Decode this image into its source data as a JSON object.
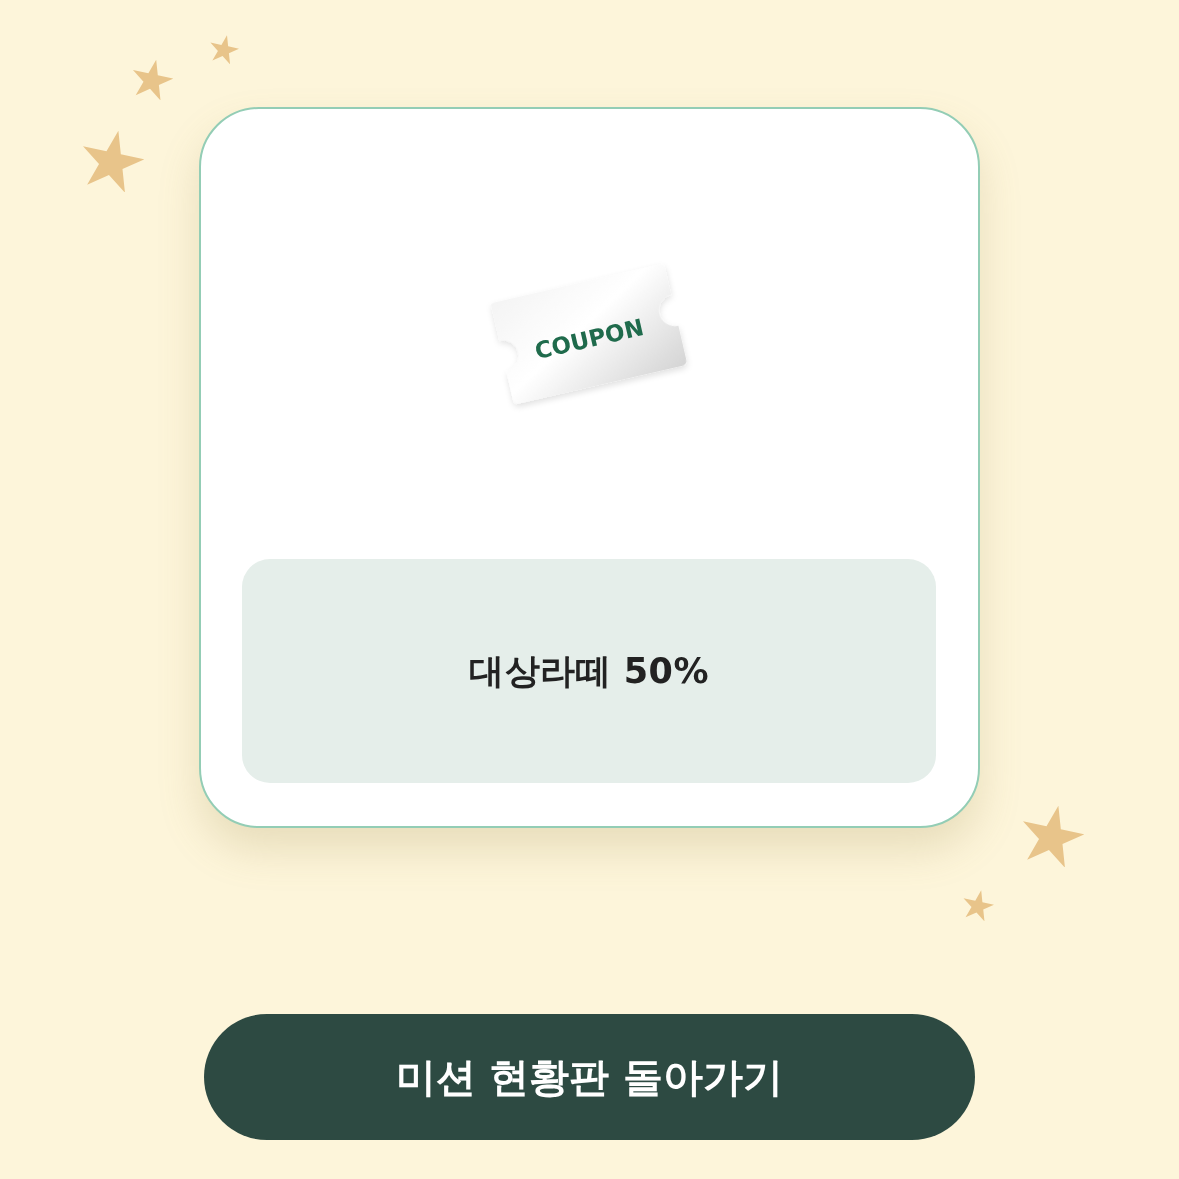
{
  "coupon_card": {
    "ticket_text": "COUPON",
    "benefit": "대상라떼 50%"
  },
  "button": {
    "label": "미션 현황판 돌아가기"
  }
}
